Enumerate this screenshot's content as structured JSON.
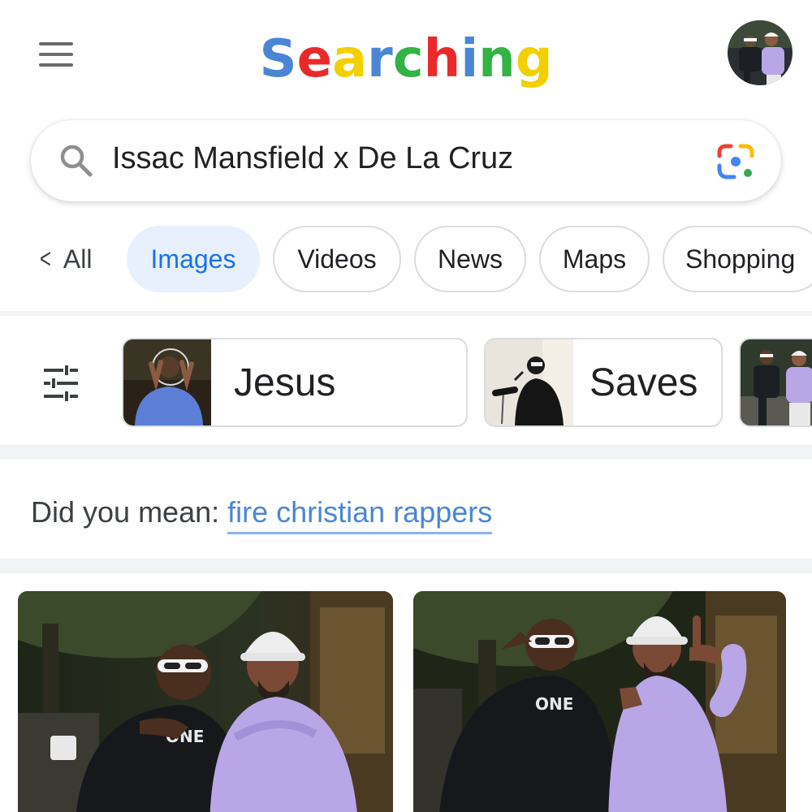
{
  "header": {
    "logo_letters": [
      {
        "ch": "S",
        "color": "#4A86D4"
      },
      {
        "ch": "e",
        "color": "#EA2A2A"
      },
      {
        "ch": "a",
        "color": "#F2D000"
      },
      {
        "ch": "r",
        "color": "#4A86D4"
      },
      {
        "ch": "c",
        "color": "#32B343"
      },
      {
        "ch": "h",
        "color": "#EA2A2A"
      },
      {
        "ch": "i",
        "color": "#4A86D4"
      },
      {
        "ch": "n",
        "color": "#32B343"
      },
      {
        "ch": "g",
        "color": "#F2D000"
      }
    ],
    "menu_icon": "hamburger-menu-icon",
    "avatar": "profile-avatar"
  },
  "search": {
    "query": "Issac Mansfield x De La Cruz",
    "search_icon": "search-icon",
    "lens_icon": "google-lens-icon"
  },
  "tabs": {
    "all_label": "All",
    "items": [
      {
        "label": "Images",
        "active": true
      },
      {
        "label": "Videos",
        "active": false
      },
      {
        "label": "News",
        "active": false
      },
      {
        "label": "Maps",
        "active": false
      },
      {
        "label": "Shopping",
        "active": false
      }
    ]
  },
  "filters": {
    "tune_icon": "tune-sliders-icon",
    "cards": [
      {
        "label": "Jesus"
      },
      {
        "label": "Saves"
      }
    ]
  },
  "did_you_mean": {
    "prefix": "Did you mean: ",
    "suggestion": "fire christian rappers"
  },
  "colors": {
    "accent_blue": "#1A73E8",
    "link_blue": "#4A86D4",
    "active_chip_bg": "#E8F0FE",
    "divider": "#F1F3F4",
    "hoodie_purple": "#B9A6E6"
  }
}
